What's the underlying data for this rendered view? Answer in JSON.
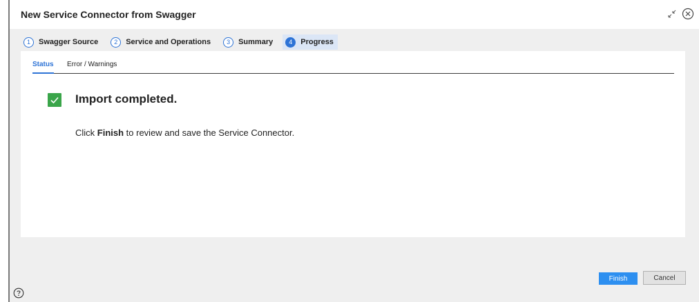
{
  "dialog": {
    "title": "New Service Connector from Swagger"
  },
  "steps": [
    {
      "number": "1",
      "label": "Swagger Source",
      "active": false
    },
    {
      "number": "2",
      "label": "Service and Operations",
      "active": false
    },
    {
      "number": "3",
      "label": "Summary",
      "active": false
    },
    {
      "number": "4",
      "label": "Progress",
      "active": true
    }
  ],
  "tabs": {
    "status": "Status",
    "errors": "Error / Warnings",
    "selected": "Status"
  },
  "status": {
    "headline": "Import completed.",
    "message_prefix": "Click ",
    "message_bold": "Finish",
    "message_suffix": " to review and save the Service Connector."
  },
  "footer": {
    "finish_label": "Finish",
    "cancel_label": "Cancel"
  },
  "icons": {
    "collapse": "collapse-arrows-icon",
    "close": "close-circle-icon",
    "check": "checkmark-icon",
    "help": "help-circle-icon"
  },
  "colors": {
    "accent": "#2d73d6",
    "success": "#3aa54a",
    "finish_button": "#2d8ff0"
  }
}
